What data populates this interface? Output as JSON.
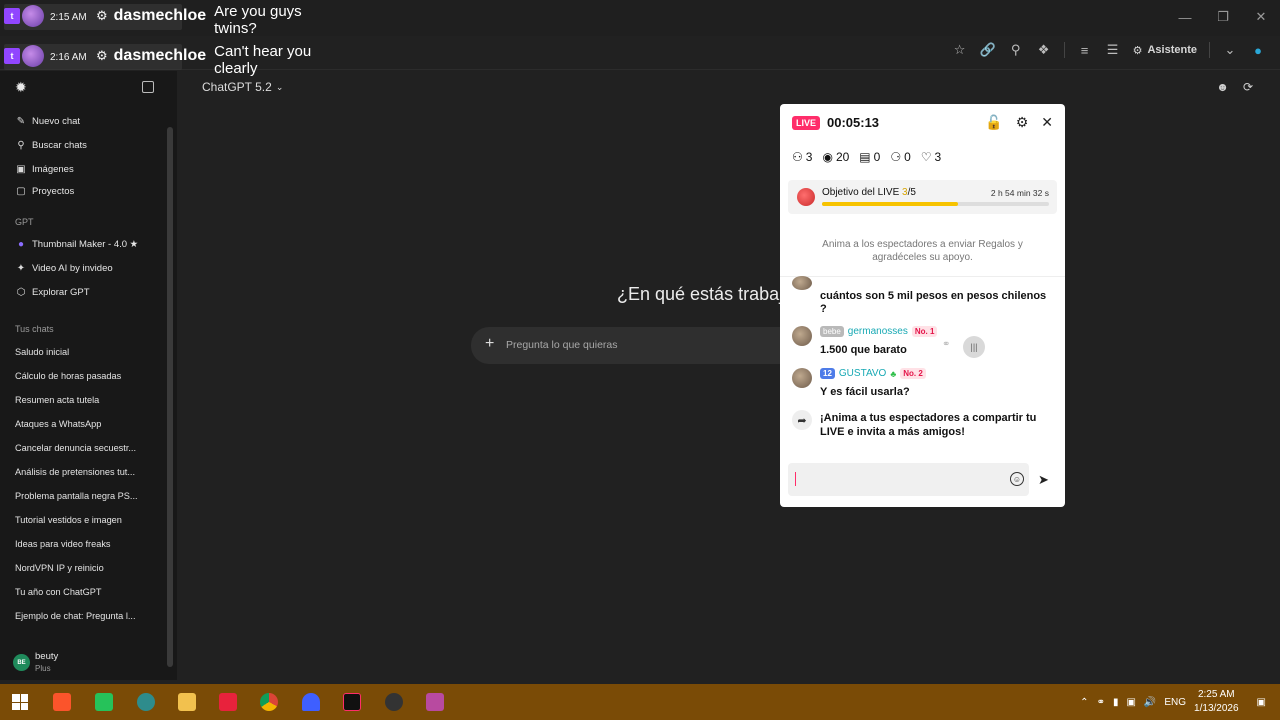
{
  "overlay": {
    "rows": [
      {
        "time": "2:15 AM",
        "user": "dasmechloe",
        "message": "Are you guys twins?"
      },
      {
        "time": "2:16 AM",
        "user": "dasmechloe",
        "message": "Can't hear you clearly"
      }
    ]
  },
  "toolbar": {
    "assistant_label": "Asistente"
  },
  "sidebar": {
    "items": [
      {
        "label": "Nuevo chat"
      },
      {
        "label": "Buscar chats"
      },
      {
        "label": "Imágenes"
      },
      {
        "label": "Proyectos"
      }
    ],
    "gpt_heading": "GPT",
    "gpts": [
      {
        "label": "Thumbnail Maker - 4.0 ★"
      },
      {
        "label": "Video AI by invideo"
      },
      {
        "label": "Explorar GPT"
      }
    ],
    "chats_heading": "Tus chats",
    "chats": [
      "Saludo inicial",
      "Cálculo de horas pasadas",
      "Resumen acta tutela",
      "Ataques a WhatsApp",
      "Cancelar denuncia secuestr...",
      "Análisis de pretensiones tut...",
      "Problema pantalla negra PS...",
      "Tutorial vestidos e imagen",
      "Ideas para video freaks",
      "NordVPN IP y reinicio",
      "Tu año con ChatGPT",
      "Ejemplo de chat: Pregunta l..."
    ],
    "user": {
      "name": "beuty",
      "plan": "Plus",
      "initials": "BE"
    }
  },
  "main": {
    "model": "ChatGPT 5.2",
    "heading": "¿En qué estás trabajando?",
    "prompt_placeholder": "Pregunta lo que quieras"
  },
  "live": {
    "badge": "LIVE",
    "timer": "00:05:13",
    "stats": {
      "users": "3",
      "views": "20",
      "gifts": "0",
      "shares": "0",
      "likes": "3"
    },
    "goal": {
      "label": "Objetivo del LIVE",
      "current": "3",
      "total": "/5",
      "time_left": "2 h 54 min 32 s",
      "progress": 0.6
    },
    "encourage": "Anima a los espectadores a enviar Regalos y agradéceles su apoyo.",
    "messages": [
      {
        "text": "cuántos son 5 mil pesos en pesos chilenos ?"
      },
      {
        "badge": "bebe",
        "user": "germanosses",
        "rank": "No. 1",
        "text": "1.500 que barato"
      },
      {
        "level": "12",
        "user": "GUSTAVO",
        "rank": "No. 2",
        "text": "Y es fácil usarla?"
      }
    ],
    "share_text": "¡Anima a tus espectadores a compartir tu LIVE e invita a más amigos!"
  },
  "taskbar": {
    "lang": "ENG",
    "time": "2:25 AM",
    "date": "1/13/2026"
  }
}
